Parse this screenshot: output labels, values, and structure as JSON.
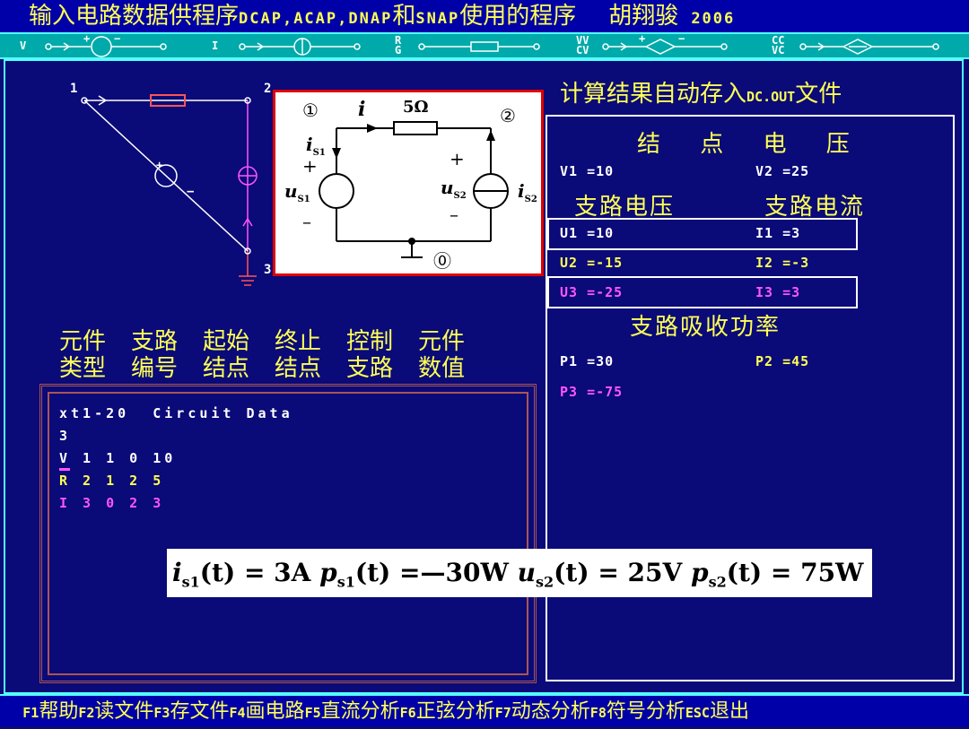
{
  "title_bar": {
    "title_prefix": "输入电路数据供程序",
    "programs_a": "DCAP,ACAP,DNAP",
    "and_text": "和",
    "programs_b": "SNAP",
    "title_suffix": "使用的程序",
    "author": "胡翔骏",
    "year": "2006"
  },
  "symbol_bar": {
    "v_label": "V",
    "i_label": "I",
    "rg_label_top": "R",
    "rg_label_bottom": "G",
    "vv_label_top": "VV",
    "vv_label_bottom": "CV",
    "cc_label_top": "CC",
    "cc_label_bottom": "VC"
  },
  "schematic": {
    "node1": "1",
    "node2": "2",
    "node3": "3"
  },
  "circuit_card": {
    "node_1": "①",
    "node_2": "②",
    "node_0": "⓪",
    "current_i": "i",
    "resistor": "5Ω",
    "is1": "i",
    "is1_sub": "S1",
    "us1": "u",
    "us1_sub": "S1",
    "us2": "u",
    "us2_sub": "S2",
    "is2": "i",
    "is2_sub": "S2",
    "plus": "+",
    "minus": "–"
  },
  "column_headers": {
    "row1": [
      "元件",
      "支路",
      "起始",
      "终止",
      "控制",
      "元件"
    ],
    "row2": [
      "类型",
      "编号",
      "结点",
      "结点",
      "支路",
      "数值"
    ]
  },
  "data_panel": {
    "title": "xt1-20  Circuit Data",
    "count": "3",
    "rows": [
      {
        "text": "V 1 1 0 10",
        "color": "#ffffff"
      },
      {
        "text": "R 2 1 2 5",
        "color": "#ffff55"
      },
      {
        "text": "I 3 0 2 3",
        "color": "#ff55ff"
      }
    ]
  },
  "results": {
    "saved_msg_prefix": "计算结果自动存入",
    "saved_file": "DC.OUT",
    "saved_msg_suffix": "文件",
    "node_voltage_header": "结 点 电 压",
    "v1": "V1 =10",
    "v2": "V2 =25",
    "branch_voltage_header": "支路电压",
    "branch_current_header": "支路电流",
    "u1": "U1 =10",
    "i1": "I1 =3",
    "u2": "U2 =-15",
    "i2": "I2 =-3",
    "u3": "U3 =-25",
    "i3": "I3 =3",
    "power_header": "支路吸收功率",
    "p1": "P1 =30",
    "p2": "P2 =45",
    "p3": "P3 =-75"
  },
  "formula": {
    "is1_lhs": "i",
    "is1_sub": "s1",
    "is1_rhs": "(t) = 3A",
    "ps1_lhs": "p",
    "ps1_sub": "s1",
    "ps1_rhs": "(t) =—30W",
    "us2_lhs": "u",
    "us2_sub": "s2",
    "us2_rhs": "(t) = 25V",
    "ps2_lhs": "p",
    "ps2_sub": "s2",
    "ps2_rhs": "(t) = 75W"
  },
  "function_bar": {
    "keys": [
      {
        "key": "F1",
        "label": "帮助"
      },
      {
        "key": "F2",
        "label": "读文件"
      },
      {
        "key": "F3",
        "label": "存文件"
      },
      {
        "key": "F4",
        "label": "画电路"
      },
      {
        "key": "F5",
        "label": "直流分析"
      },
      {
        "key": "F6",
        "label": "正弦分析"
      },
      {
        "key": "F7",
        "label": "动态分析"
      },
      {
        "key": "F8",
        "label": "符号分析"
      },
      {
        "key": "ESC",
        "label": "退出"
      }
    ]
  },
  "colors": {
    "background": "#0a0a78",
    "title_text": "#ffff55",
    "symbol_bar": "#00aaaa",
    "highlight_red": "#e00000"
  }
}
